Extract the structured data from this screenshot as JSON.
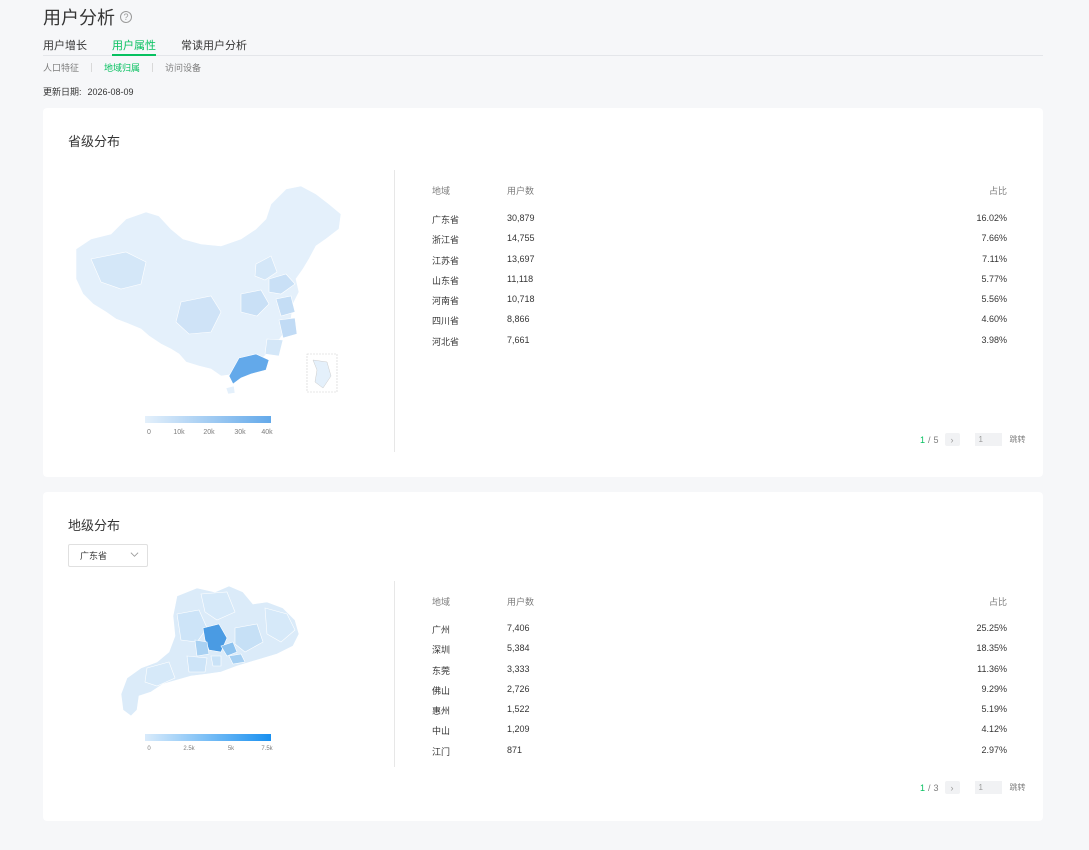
{
  "page": {
    "title": "用户分析",
    "help_icon": "question-circle-icon"
  },
  "tabs": [
    {
      "label": "用户增长",
      "active": false
    },
    {
      "label": "用户属性",
      "active": true
    },
    {
      "label": "常读用户分析",
      "active": false
    }
  ],
  "subtabs": [
    {
      "label": "人口特征",
      "active": false
    },
    {
      "label": "地域归属",
      "active": true
    },
    {
      "label": "访问设备",
      "active": false
    }
  ],
  "update": {
    "label": "更新日期:",
    "date": "2026-08-09"
  },
  "province_section": {
    "title": "省级分布",
    "legend": {
      "ticks": [
        "0",
        "10k",
        "20k",
        "30k",
        "40k"
      ],
      "colors": [
        "#e4f0fb",
        "#63a9ea"
      ]
    },
    "table": {
      "headers": {
        "region": "地域",
        "users": "用户数",
        "share": "占比"
      },
      "rows": [
        {
          "region": "广东省",
          "users": "30,879",
          "share": "16.02%"
        },
        {
          "region": "浙江省",
          "users": "14,755",
          "share": "7.66%"
        },
        {
          "region": "江苏省",
          "users": "13,697",
          "share": "7.11%"
        },
        {
          "region": "山东省",
          "users": "11,118",
          "share": "5.77%"
        },
        {
          "region": "河南省",
          "users": "10,718",
          "share": "5.56%"
        },
        {
          "region": "四川省",
          "users": "8,866",
          "share": "4.60%"
        },
        {
          "region": "河北省",
          "users": "7,661",
          "share": "3.98%"
        }
      ]
    },
    "pager": {
      "current": "1",
      "total": "5",
      "separator": "/",
      "input_value": "1",
      "jump_label": "跳转",
      "next_icon": "chevron-right-icon"
    }
  },
  "city_section": {
    "title": "地级分布",
    "select": {
      "value": "广东省",
      "icon": "chevron-down-icon"
    },
    "legend": {
      "ticks": [
        "0",
        "2.5k",
        "5k",
        "7.5k"
      ],
      "colors": [
        "#d9ebfb",
        "#1890f0"
      ]
    },
    "table": {
      "headers": {
        "region": "地域",
        "users": "用户数",
        "share": "占比"
      },
      "rows": [
        {
          "region": "广州",
          "users": "7,406",
          "share": "25.25%"
        },
        {
          "region": "深圳",
          "users": "5,384",
          "share": "18.35%"
        },
        {
          "region": "东莞",
          "users": "3,333",
          "share": "11.36%"
        },
        {
          "region": "佛山",
          "users": "2,726",
          "share": "9.29%"
        },
        {
          "region": "惠州",
          "users": "1,522",
          "share": "5.19%"
        },
        {
          "region": "中山",
          "users": "1,209",
          "share": "4.12%"
        },
        {
          "region": "江门",
          "users": "871",
          "share": "2.97%"
        }
      ]
    },
    "pager": {
      "current": "1",
      "total": "3",
      "separator": "/",
      "input_value": "1",
      "jump_label": "跳转",
      "next_icon": "chevron-right-icon"
    }
  },
  "colors": {
    "accent": "#07c160",
    "map_light": "#e4f0fb",
    "map_mid": "#bcd9f4",
    "map_dark": "#63a9ea",
    "city_dark": "#4a9be3"
  }
}
